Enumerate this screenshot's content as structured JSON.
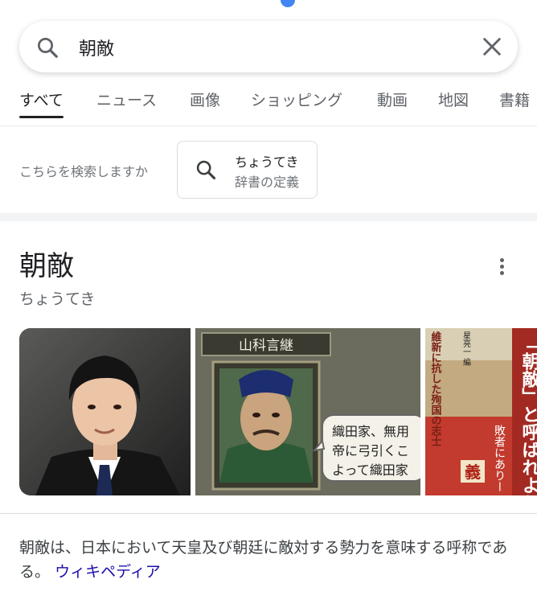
{
  "search": {
    "query": "朝敵"
  },
  "tabs": [
    {
      "label": "すべて",
      "active": true
    },
    {
      "label": "ニュース",
      "active": false
    },
    {
      "label": "画像",
      "active": false
    },
    {
      "label": "ショッピング",
      "active": false
    },
    {
      "label": "動画",
      "active": false
    },
    {
      "label": "地図",
      "active": false
    },
    {
      "label": "書籍",
      "active": false
    }
  ],
  "suggestion": {
    "prompt": "こちらを検索しますか",
    "chip_line1": "ちょうてき",
    "chip_line2": "辞書の定義"
  },
  "knowledge_panel": {
    "title": "朝敵",
    "reading": "ちょうてき",
    "images": [
      {
        "name": "portrait-photo"
      },
      {
        "name": "game-character-portrait",
        "caption": "山科言継",
        "bubble": [
          "織田家、無用",
          "帝に弓引くこ",
          "よって織田家"
        ]
      },
      {
        "name": "book-cover",
        "text_main": "「朝敵」と呼ばれようとも",
        "text_side": "維新に抗した殉国の志士",
        "author": "星亮一 編",
        "text_bottom": "敗者にありー",
        "badge": "義"
      }
    ],
    "description": "朝敵は、日本において天皇及び朝廷に敵対する勢力を意味する呼称である。",
    "source_link": "ウィキペディア"
  },
  "colors": {
    "accent": "#4285f4",
    "link": "#1a0dab",
    "text": "#202124",
    "muted": "#5f6368"
  }
}
